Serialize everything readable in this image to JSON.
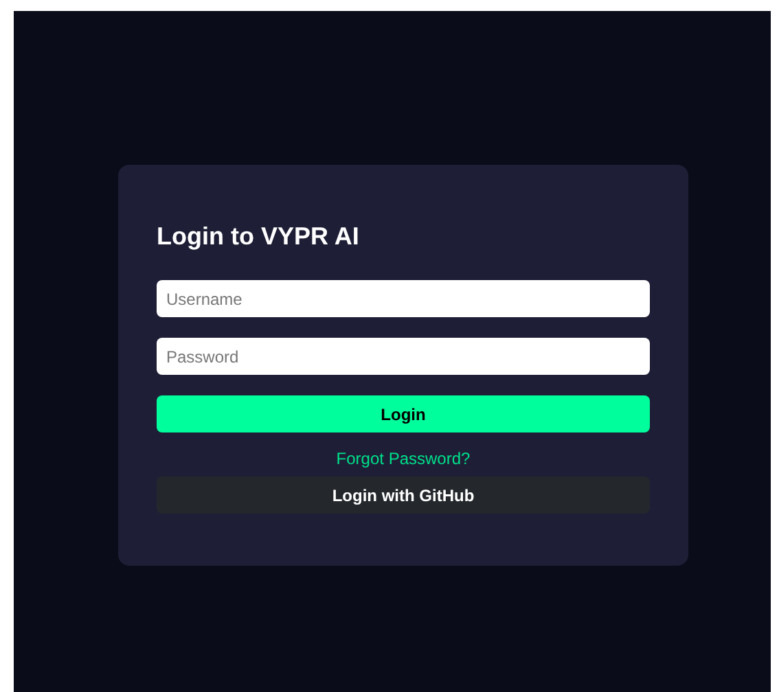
{
  "login_card": {
    "title": "Login to VYPR AI",
    "username": {
      "placeholder": "Username"
    },
    "password": {
      "placeholder": "Password"
    },
    "login_button": "Login",
    "forgot_link": "Forgot Password?",
    "github_button": "Login with GitHub"
  }
}
